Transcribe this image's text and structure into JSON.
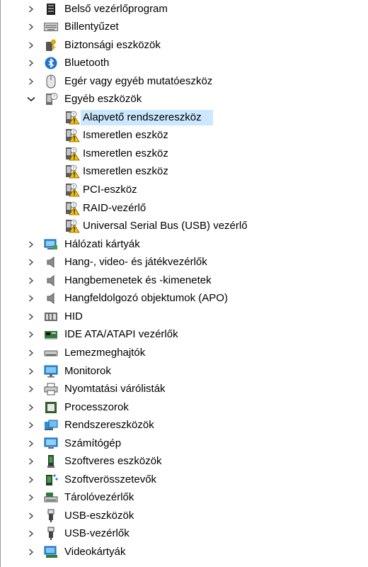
{
  "categories": [
    {
      "label": "Belső vezérlőprogram",
      "icon": "firmware-icon"
    },
    {
      "label": "Billentyűzet",
      "icon": "keyboard-icon"
    },
    {
      "label": "Biztonsági eszközök",
      "icon": "security-key-icon"
    },
    {
      "label": "Bluetooth",
      "icon": "bluetooth-icon"
    },
    {
      "label": "Egér vagy egyéb mutatóeszköz",
      "icon": "mouse-icon"
    },
    {
      "label": "Egyéb eszközök",
      "icon": "unknown-device-icon",
      "expanded": true,
      "children": [
        {
          "label": "Alapvető rendszereszköz",
          "selected": true
        },
        {
          "label": "Ismeretlen eszköz"
        },
        {
          "label": "Ismeretlen eszköz"
        },
        {
          "label": "Ismeretlen eszköz"
        },
        {
          "label": "PCI-eszköz"
        },
        {
          "label": "RAID-vezérlő"
        },
        {
          "label": "Universal Serial Bus (USB) vezérlő"
        }
      ]
    },
    {
      "label": "Hálózati kártyák",
      "icon": "network-adapter-icon"
    },
    {
      "label": "Hang-, video- és játékvezérlők",
      "icon": "speaker-icon"
    },
    {
      "label": "Hangbemenetek és -kimenetek",
      "icon": "speaker-icon"
    },
    {
      "label": "Hangfeldolgozó objektumok (APO)",
      "icon": "speaker-icon"
    },
    {
      "label": "HID",
      "icon": "hid-icon"
    },
    {
      "label": "IDE ATA/ATAPI vezérlők",
      "icon": "ide-controller-icon"
    },
    {
      "label": "Lemezmeghajtók",
      "icon": "disk-drive-icon"
    },
    {
      "label": "Monitorok",
      "icon": "monitor-icon"
    },
    {
      "label": "Nyomtatási várólisták",
      "icon": "printer-icon"
    },
    {
      "label": "Processzorok",
      "icon": "processor-icon"
    },
    {
      "label": "Rendszereszközök",
      "icon": "system-devices-icon"
    },
    {
      "label": "Számítógép",
      "icon": "computer-icon"
    },
    {
      "label": "Szoftveres eszközök",
      "icon": "software-device-icon"
    },
    {
      "label": "Szoftverösszetevők",
      "icon": "software-component-icon"
    },
    {
      "label": "Tárolóvezérlők",
      "icon": "storage-controller-icon"
    },
    {
      "label": "USB-eszközök",
      "icon": "usb-icon"
    },
    {
      "label": "USB-vezérlők",
      "icon": "usb-icon"
    },
    {
      "label": "Videokártyák",
      "icon": "display-adapter-icon"
    }
  ],
  "colors": {
    "selection": "#cce8ff",
    "warning": "#f5c400",
    "chevron": "#404040"
  }
}
